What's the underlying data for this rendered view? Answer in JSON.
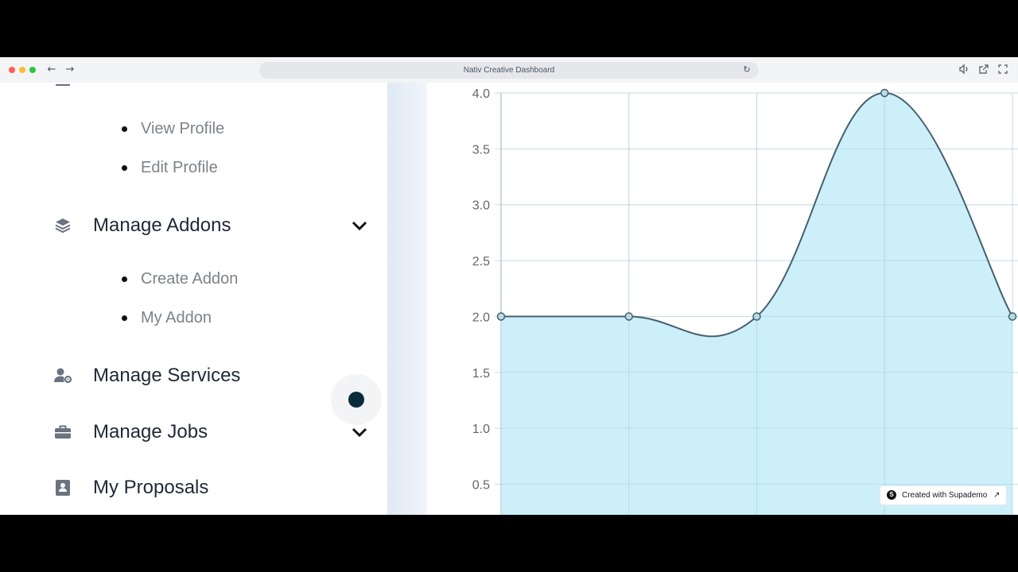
{
  "browser": {
    "title": "Nativ Creative Dashboard"
  },
  "sidebar": {
    "profile_subitems": [
      "View Profile",
      "Edit Profile"
    ],
    "manage_addons": {
      "label": "Manage Addons",
      "icon": "layers-icon",
      "subitems": [
        "Create Addon",
        "My Addon"
      ]
    },
    "manage_services": {
      "label": "Manage Services",
      "icon": "user-gear-icon"
    },
    "manage_jobs": {
      "label": "Manage Jobs",
      "icon": "briefcase-icon"
    },
    "my_proposals": {
      "label": "My Proposals",
      "icon": "address-book-icon"
    }
  },
  "chart_data": {
    "type": "area",
    "x": [
      0,
      1,
      2,
      3,
      4
    ],
    "values": [
      2,
      2,
      2,
      4,
      2
    ],
    "yticks": [
      "4.0",
      "3.5",
      "3.0",
      "2.5",
      "2.0",
      "1.5",
      "1.0",
      "0.5"
    ],
    "ylim": [
      0.5,
      4.0
    ],
    "grid": true,
    "fill_color": "#c9eefa",
    "line_color": "#44616e"
  },
  "badge": {
    "text": "Created with Supademo",
    "logo_letter": "S"
  }
}
